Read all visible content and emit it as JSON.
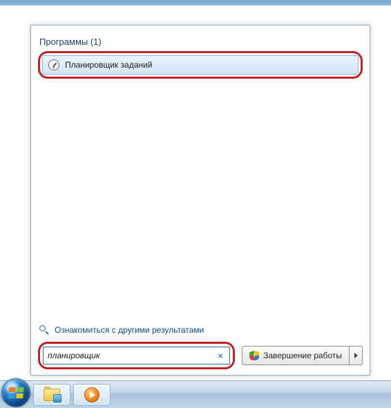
{
  "search_results": {
    "section_header": "Программы (1)",
    "top_result_label": "Планировщик заданий"
  },
  "more_results_link": "Ознакомиться с другими результатами",
  "search": {
    "query": "планировщик"
  },
  "shutdown_label": "Завершение работы",
  "colors": {
    "highlight_ring": "#c3201f",
    "selection_bg_top": "#eaf3fb",
    "selection_bg_bottom": "#d3e7f8",
    "link": "#0a4a8a"
  }
}
